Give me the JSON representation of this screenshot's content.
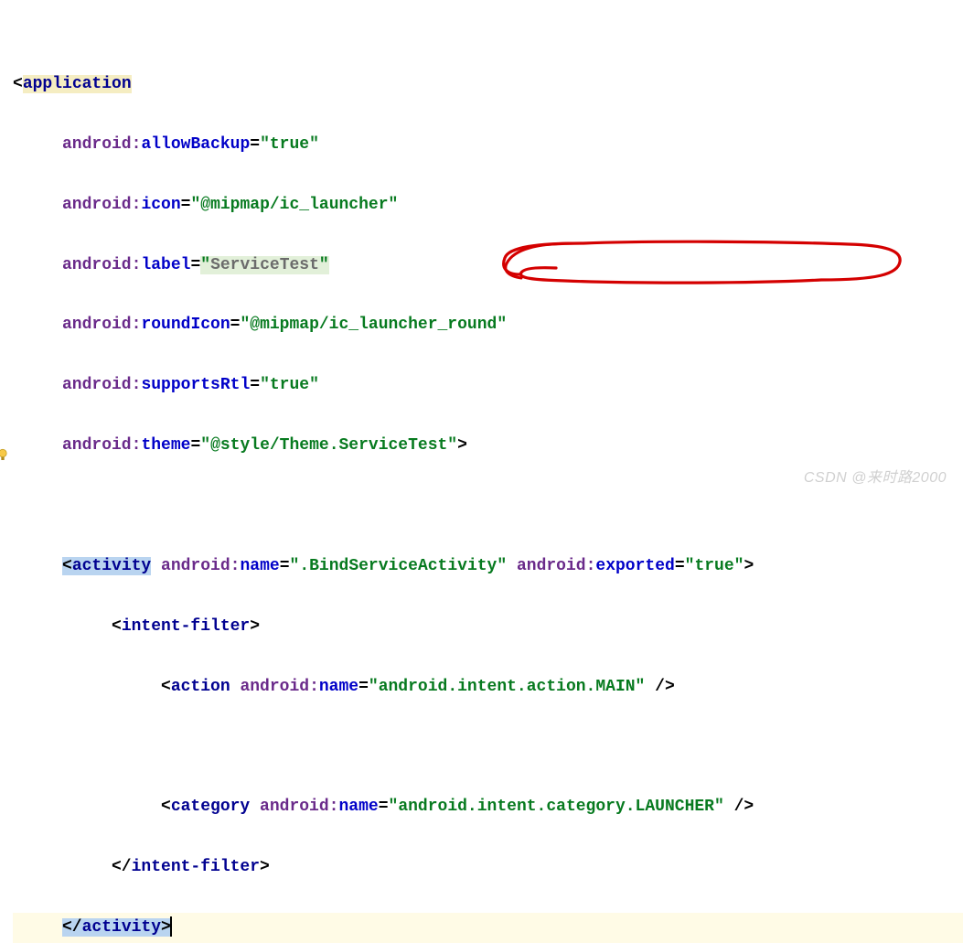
{
  "lines": {
    "l1_open": "<",
    "l1_tag": "application",
    "l2_ns": "android",
    "l2_colon": ":",
    "l2_attr": "allowBackup",
    "l2_eq": "=",
    "l2_val": "\"true\"",
    "l3_ns": "android",
    "l3_colon": ":",
    "l3_attr": "icon",
    "l3_eq": "=",
    "l3_val": "\"@mipmap/ic_launcher\"",
    "l4_ns": "android",
    "l4_colon": ":",
    "l4_attr": "label",
    "l4_eq": "=",
    "l4_q1": "\"",
    "l4_val": "ServiceTest",
    "l4_q2": "\"",
    "l5_ns": "android",
    "l5_colon": ":",
    "l5_attr": "roundIcon",
    "l5_eq": "=",
    "l5_val": "\"@mipmap/ic_launcher_round\"",
    "l6_ns": "android",
    "l6_colon": ":",
    "l6_attr": "supportsRtl",
    "l6_eq": "=",
    "l6_val": "\"true\"",
    "l7_ns": "android",
    "l7_colon": ":",
    "l7_attr": "theme",
    "l7_eq": "=",
    "l7_val": "\"@style/Theme.ServiceTest\"",
    "l7_close": ">",
    "l8_open": "<",
    "l8_tag": "activity",
    "l8_sp": " ",
    "l8_ns1": "android",
    "l8_colon1": ":",
    "l8_attr1": "name",
    "l8_eq1": "=",
    "l8_val1": "\".BindServiceActivity\"",
    "l8_sp2": " ",
    "l8_ns2": "android",
    "l8_colon2": ":",
    "l8_attr2": "exported",
    "l8_eq2": "=",
    "l8_val2": "\"true\"",
    "l8_close": ">",
    "l9_open": "<",
    "l9_tag": "intent-filter",
    "l9_close": ">",
    "l10_open": "<",
    "l10_tag": "action",
    "l10_sp": " ",
    "l10_ns": "android",
    "l10_colon": ":",
    "l10_attr": "name",
    "l10_eq": "=",
    "l10_val": "\"android.intent.action.MAIN\"",
    "l10_close": " />",
    "l11_open": "<",
    "l11_tag": "category",
    "l11_sp": " ",
    "l11_ns": "android",
    "l11_colon": ":",
    "l11_attr": "name",
    "l11_eq": "=",
    "l11_val": "\"android.intent.category.LAUNCHER\"",
    "l11_close": " />",
    "l12_open": "</",
    "l12_tag": "intent-filter",
    "l12_close": ">",
    "l13_open": "</",
    "l13_tag": "activity",
    "l13_close": ">"
  },
  "watermark": "CSDN @来时路2000"
}
